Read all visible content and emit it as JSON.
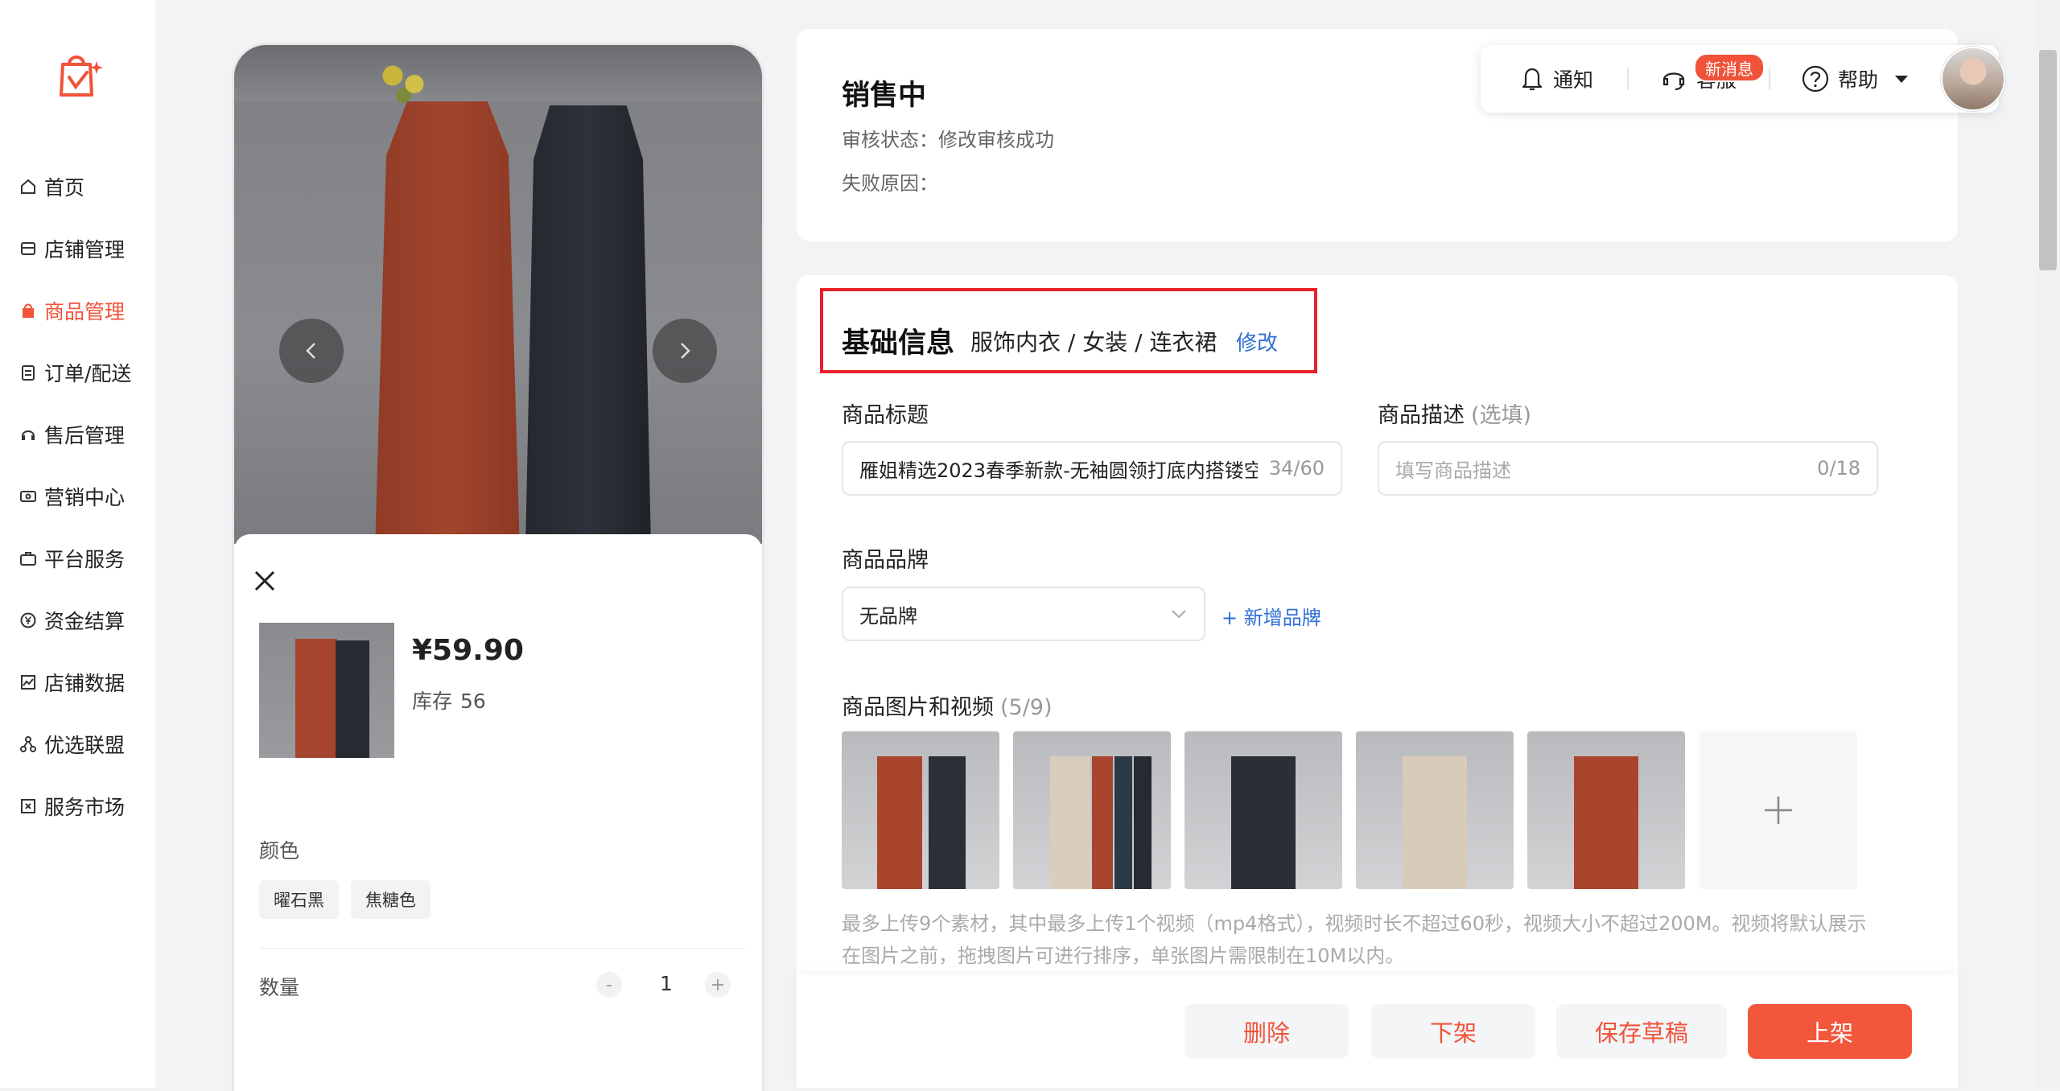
{
  "sidebar": {
    "items": [
      {
        "label": "首页",
        "icon": "home-icon"
      },
      {
        "label": "店铺管理",
        "icon": "store-icon"
      },
      {
        "label": "商品管理",
        "icon": "bag-icon"
      },
      {
        "label": "订单/配送",
        "icon": "order-icon"
      },
      {
        "label": "售后管理",
        "icon": "headset-icon"
      },
      {
        "label": "营销中心",
        "icon": "coupon-icon"
      },
      {
        "label": "平台服务",
        "icon": "briefcase-icon"
      },
      {
        "label": "资金结算",
        "icon": "yen-icon"
      },
      {
        "label": "店铺数据",
        "icon": "chart-icon"
      },
      {
        "label": "优选联盟",
        "icon": "network-icon"
      },
      {
        "label": "服务市场",
        "icon": "market-icon"
      }
    ],
    "active_index": 2
  },
  "preview": {
    "price": "¥59.90",
    "stock_label": "库存",
    "stock_value": "56",
    "color_label": "颜色",
    "colors": [
      "曜石黑",
      "焦糖色"
    ],
    "quantity_label": "数量",
    "quantity": "1",
    "minus": "-",
    "plus": "+"
  },
  "status": {
    "title": "销售中",
    "audit_line": "审核状态：修改审核成功",
    "fail_line": "失败原因："
  },
  "topbar": {
    "notify": "通知",
    "service": "客服",
    "badge": "新消息",
    "help": "帮助"
  },
  "basic": {
    "title": "基础信息",
    "category": "服饰内衣 / 女装 / 连衣裙",
    "edit": "修改"
  },
  "form": {
    "product_title_label": "商品标题",
    "product_title_value": "雁姐精选2023春季新款-无袖圆领打底内搭镂空",
    "product_title_count": "34/60",
    "desc_label": "商品描述",
    "desc_optional": "(选填)",
    "desc_placeholder": "填写商品描述",
    "desc_count": "0/18",
    "brand_label": "商品品牌",
    "brand_value": "无品牌",
    "add_brand": "+ 新增品牌",
    "media_label": "商品图片和视频",
    "media_count": "(5/9)",
    "media_hint": "最多上传9个素材，其中最多上传1个视频（mp4格式），视频时长不超过60秒，视频大小不超过200M。视频将默认展示在图片之前，拖拽图片可进行排序，单张图片需限制在10M以内。"
  },
  "actions": {
    "delete": "删除",
    "unlist": "下架",
    "save_draft": "保存草稿",
    "list": "上架"
  },
  "colors": {
    "accent": "#f0533a",
    "link": "#2f6fd6",
    "highlight_border": "#e8202a"
  }
}
